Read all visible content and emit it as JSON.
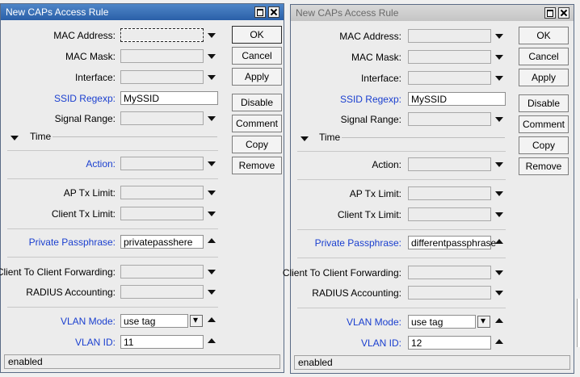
{
  "windows": [
    {
      "title": "New CAPs Access Rule",
      "labels": {
        "mac_address": "MAC Address:",
        "mac_mask": "MAC Mask:",
        "interface": "Interface:",
        "ssid_regexp": "SSID Regexp:",
        "signal_range": "Signal Range:",
        "time": "Time",
        "action": "Action:",
        "ap_tx_limit": "AP Tx Limit:",
        "client_tx_limit": "Client Tx Limit:",
        "private_passphrase": "Private Passphrase:",
        "client_to_client": "Client To Client Forwarding:",
        "radius_accounting": "RADIUS Accounting:",
        "vlan_mode": "VLAN Mode:",
        "vlan_id": "VLAN ID:"
      },
      "values": {
        "ssid_regexp": "MySSID",
        "private_passphrase": "privatepasshere",
        "vlan_mode": "use tag",
        "vlan_id": "11"
      },
      "buttons": {
        "ok": "OK",
        "cancel": "Cancel",
        "apply": "Apply",
        "disable": "Disable",
        "comment": "Comment",
        "copy": "Copy",
        "remove": "Remove"
      },
      "status": "enabled"
    },
    {
      "title": "New CAPs Access Rule",
      "labels": {
        "mac_address": "MAC Address:",
        "mac_mask": "MAC Mask:",
        "interface": "Interface:",
        "ssid_regexp": "SSID Regexp:",
        "signal_range": "Signal Range:",
        "time": "Time",
        "action": "Action:",
        "ap_tx_limit": "AP Tx Limit:",
        "client_tx_limit": "Client Tx Limit:",
        "private_passphrase": "Private Passphrase:",
        "client_to_client": "Client To Client Forwarding:",
        "radius_accounting": "RADIUS Accounting:",
        "vlan_mode": "VLAN Mode:",
        "vlan_id": "VLAN ID:"
      },
      "values": {
        "ssid_regexp": "MySSID",
        "private_passphrase": "differentpassphrase",
        "vlan_mode": "use tag",
        "vlan_id": "12"
      },
      "buttons": {
        "ok": "OK",
        "cancel": "Cancel",
        "apply": "Apply",
        "disable": "Disable",
        "comment": "Comment",
        "copy": "Copy",
        "remove": "Remove"
      },
      "status": "enabled"
    }
  ]
}
